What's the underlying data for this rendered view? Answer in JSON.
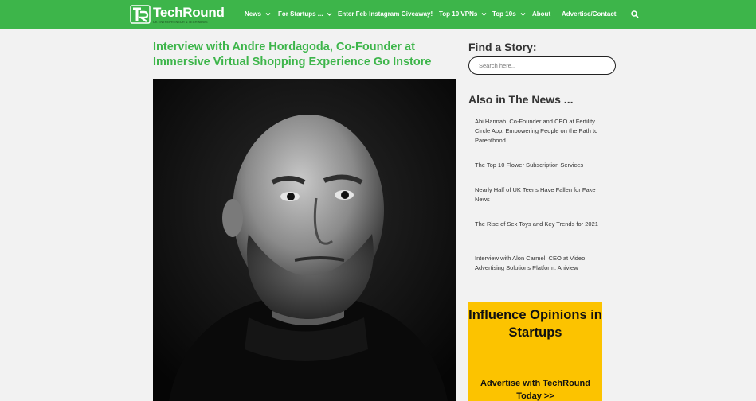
{
  "brand": {
    "name": "TechRound",
    "tagline": "UK ENTREPRENEUR & TECH NEWS",
    "accent": "#3db54a"
  },
  "nav": {
    "items": [
      {
        "label": "News",
        "dropdown": true
      },
      {
        "label": "For Startups ...",
        "dropdown": true
      },
      {
        "label": "Enter Feb Instagram Giveaway!",
        "dropdown": false
      },
      {
        "label": "Top 10 VPNs",
        "dropdown": true
      },
      {
        "label": "Top 10s",
        "dropdown": true
      },
      {
        "label": "About",
        "dropdown": false
      },
      {
        "label": "Advertise/Contact",
        "dropdown": false
      }
    ],
    "search_icon": "search-icon"
  },
  "article": {
    "title": "Interview with Andre Hordagoda, Co-Founder at Immersive Virtual Shopping Experience Go Instore"
  },
  "sidebar": {
    "find_heading": "Find a Story:",
    "search_placeholder": "Search here..",
    "news_heading": "Also in The News ...",
    "news": [
      "Abi Hannah, Co-Founder and CEO at Fertility Circle App: Empowering People on the Path to Parenthood",
      "The Top 10 Flower Subscription Services",
      "Nearly Half of UK Teens Have Fallen for Fake News",
      "The Rise of Sex Toys and Key Trends for 2021",
      "Interview with Alon Carmel, CEO at Video Advertising Solutions Platform: Aniview"
    ],
    "ad": {
      "title": "Influence Opinions in Startups",
      "cta": "Advertise with TechRound Today >>",
      "color": "#fcc300"
    }
  }
}
